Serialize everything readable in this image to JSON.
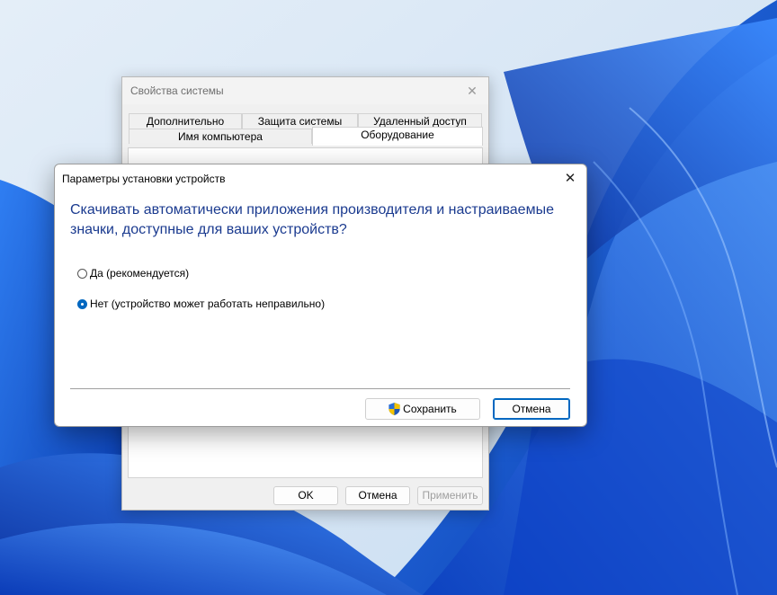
{
  "system_properties": {
    "title": "Свойства системы",
    "tabs_row1": [
      "Дополнительно",
      "Защита системы",
      "Удаленный доступ"
    ],
    "tabs_row2": [
      "Имя компьютера",
      "Оборудование"
    ],
    "active_tab": "Оборудование",
    "buttons": {
      "ok": "OK",
      "cancel": "Отмена",
      "apply": "Применить"
    }
  },
  "dialog": {
    "title": "Параметры установки устройств",
    "question": "Скачивать автоматически приложения производителя и настраиваемые значки, доступные для ваших устройств?",
    "options": [
      {
        "label": "Да (рекомендуется)",
        "checked": false
      },
      {
        "label": "Нет (устройство может работать неправильно)",
        "checked": true
      }
    ],
    "save_label": "Сохранить",
    "cancel_label": "Отмена"
  },
  "colors": {
    "accent": "#0067c0",
    "heading_text": "#1a3a8f",
    "wallpaper_base": "#d6e6f5",
    "wallpaper_bloom": "#0a4fd6"
  },
  "icons": [
    "close-icon",
    "uac-shield-icon",
    "radio-icon"
  ]
}
